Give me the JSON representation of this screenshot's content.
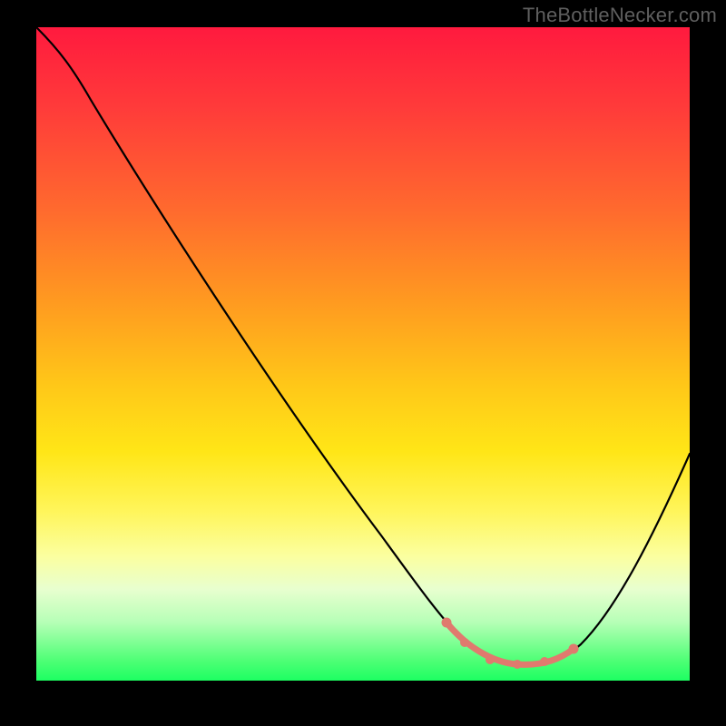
{
  "watermark": "TheBottleNecker.com",
  "colors": {
    "gradient_top": "#ff1a3e",
    "gradient_bottom": "#1dff62",
    "curve": "#000000",
    "salmon": "#e07a6e",
    "frame": "#000000",
    "watermark_text": "#5f5f5f"
  },
  "chart_data": {
    "type": "line",
    "title": "",
    "xlabel": "",
    "ylabel": "",
    "xlim": [
      0,
      100
    ],
    "ylim": [
      0,
      100
    ],
    "series": [
      {
        "name": "main-curve",
        "x": [
          0,
          6,
          12,
          20,
          30,
          40,
          50,
          58,
          62,
          66,
          70,
          74,
          78,
          82,
          88,
          94,
          100
        ],
        "y": [
          100,
          96,
          89,
          78,
          63,
          48,
          33,
          20,
          13,
          8,
          4,
          2,
          2,
          4,
          12,
          24,
          38
        ]
      }
    ],
    "highlight_segment": {
      "x_start": 62,
      "x_end": 82,
      "points": [
        {
          "x": 62,
          "y": 13
        },
        {
          "x": 66,
          "y": 8
        },
        {
          "x": 70,
          "y": 4
        },
        {
          "x": 74,
          "y": 2
        },
        {
          "x": 78,
          "y": 2
        },
        {
          "x": 82,
          "y": 4
        }
      ]
    }
  }
}
